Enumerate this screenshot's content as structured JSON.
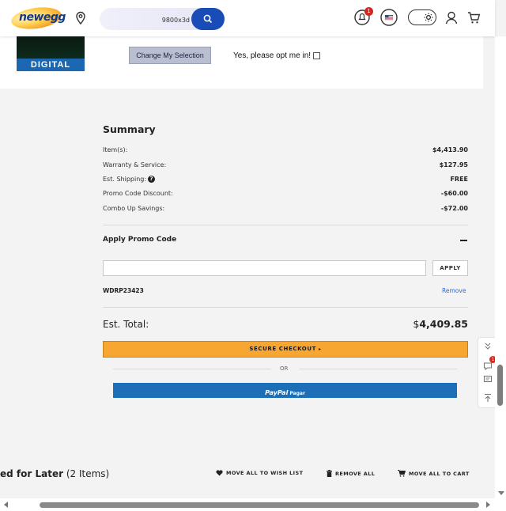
{
  "header": {
    "logo_text": "newegg",
    "search_value": "9800x3d",
    "notification_count": "1",
    "flag": "US"
  },
  "top_strip": {
    "digital_label": "DIGITAL",
    "change_selection_label": "Change My Selection",
    "optin_label": "Yes, please opt me in!"
  },
  "summary": {
    "title": "Summary",
    "rows": [
      {
        "label": "Item(s):",
        "value": "$4,413.90"
      },
      {
        "label": "Warranty & Service:",
        "value": "$127.95"
      },
      {
        "label": "Est. Shipping:",
        "value": "FREE"
      },
      {
        "label": "Promo Code Discount:",
        "value": "-$60.00"
      },
      {
        "label": "Combo Up Savings:",
        "value": "-$72.00"
      }
    ],
    "promo_title": "Apply Promo Code",
    "promo_placeholder": "",
    "apply_label": "APPLY",
    "applied_code": "WDRP23423",
    "remove_label": "Remove",
    "total_label": "Est. Total:",
    "total_currency": "$",
    "total_value": "4,409.85",
    "checkout_label": "SECURE CHECKOUT",
    "or_label": "OR",
    "paypal_label": "PayPal",
    "paypal_sub": "Pagar"
  },
  "saved": {
    "title_bold": "ed for Later",
    "count": "(2 Items)",
    "move_wish": "MOVE ALL TO WISH LIST",
    "remove_all": "REMOVE ALL",
    "move_cart": "MOVE ALL TO CART"
  },
  "side_tools": {
    "chat_count": "1"
  },
  "colors": {
    "brand_blue": "#1a4cb7",
    "checkout_orange": "#f7a731",
    "paypal_blue": "#1c6fb7",
    "link_blue": "#2f6ad9",
    "badge_red": "#d8261d"
  }
}
